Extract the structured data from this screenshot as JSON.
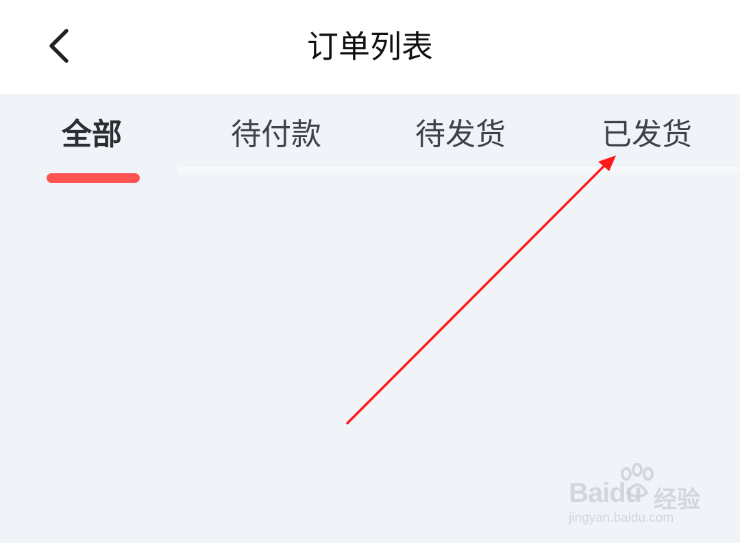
{
  "header": {
    "title": "订单列表",
    "back_icon": "chevron-left-icon"
  },
  "tabs": [
    {
      "label": "全部",
      "active": true
    },
    {
      "label": "待付款",
      "active": false
    },
    {
      "label": "待发货",
      "active": false
    },
    {
      "label": "已发货",
      "active": false
    }
  ],
  "colors": {
    "accent": "#ff5352",
    "header_bg": "#ffffff",
    "page_bg": "#f0f3f7",
    "annotation_arrow": "#ff1a1a"
  },
  "watermark": {
    "brand": "Baidu",
    "brand_cn": "经验",
    "url": "jingyan.baidu.com"
  }
}
